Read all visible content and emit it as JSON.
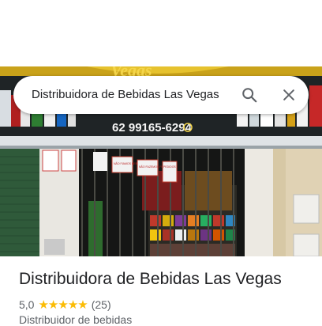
{
  "search": {
    "query": "Distribuidora de Bebidas Las Vegas"
  },
  "photo": {
    "sign_phone": "62 99165-6294",
    "sign_name_fragment": "Vegas",
    "notice_1": "NÃO FIAMOS BEBIDAS",
    "notice_2": "NÃO FAZEMOS FIADO",
    "notice_3": "PEDIDOS"
  },
  "place": {
    "name": "Distribuidora de Bebidas Las Vegas",
    "rating": "5,0",
    "stars": 5,
    "review_count": "(25)",
    "category": "Distribuidor de bebidas"
  },
  "icons": {
    "search": "search-icon",
    "close": "close-icon",
    "star": "star-icon"
  },
  "colors": {
    "star": "#fbbc04",
    "icon": "#5f6368"
  }
}
